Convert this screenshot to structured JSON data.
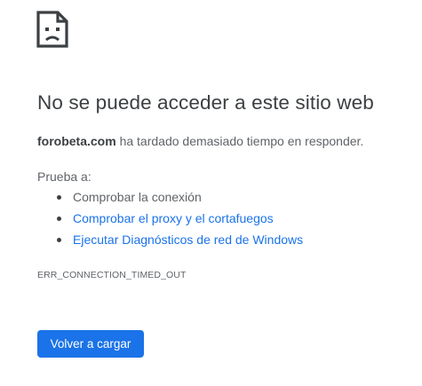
{
  "error": {
    "icon": "sad-page-icon",
    "title": "No se puede acceder a este sitio web",
    "summary": {
      "domain": "forobeta.com",
      "message": " ha tardado demasiado tiempo en responder."
    },
    "suggestions_heading": "Prueba a:",
    "suggestions": [
      {
        "label": "Comprobar la conexión",
        "is_link": false
      },
      {
        "label": "Comprobar el proxy y el cortafuegos",
        "is_link": true
      },
      {
        "label": "Ejecutar Diagnósticos de red de Windows",
        "is_link": true
      }
    ],
    "code": "ERR_CONNECTION_TIMED_OUT",
    "reload_label": "Volver a cargar"
  },
  "colors": {
    "accent": "#1a73e8",
    "title": "#3c4043",
    "text": "#5f6368"
  }
}
